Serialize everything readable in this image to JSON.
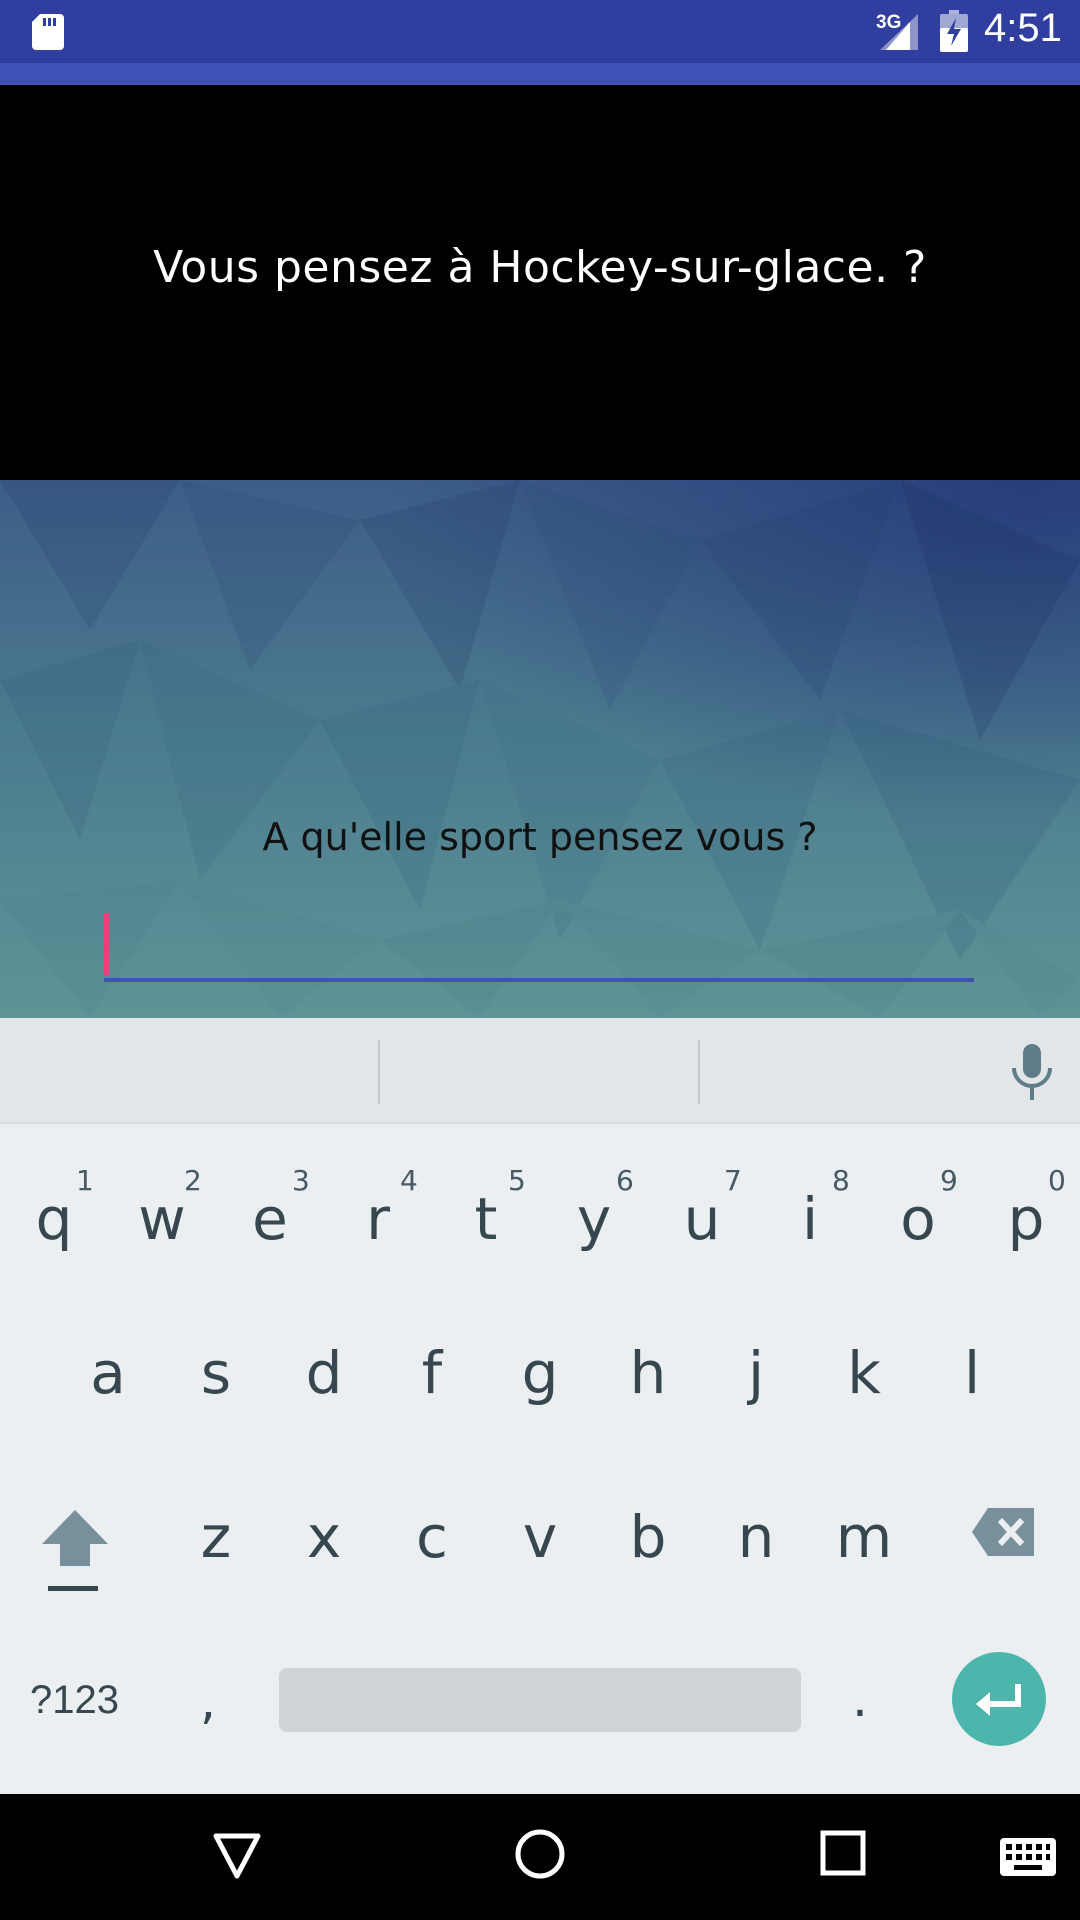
{
  "status_bar": {
    "network": "3G",
    "time": "4:51",
    "icons": [
      "sd-card-icon",
      "signal-icon",
      "battery-charging-icon"
    ]
  },
  "question": {
    "text": "Vous pensez à Hockey-sur-glace. ?"
  },
  "answer": {
    "prompt": "A qu'elle sport pensez vous ?",
    "input_value": ""
  },
  "keyboard": {
    "suggestions": [
      "",
      "",
      ""
    ],
    "row1": [
      {
        "letter": "q",
        "digit": "1"
      },
      {
        "letter": "w",
        "digit": "2"
      },
      {
        "letter": "e",
        "digit": "3"
      },
      {
        "letter": "r",
        "digit": "4"
      },
      {
        "letter": "t",
        "digit": "5"
      },
      {
        "letter": "y",
        "digit": "6"
      },
      {
        "letter": "u",
        "digit": "7"
      },
      {
        "letter": "i",
        "digit": "8"
      },
      {
        "letter": "o",
        "digit": "9"
      },
      {
        "letter": "p",
        "digit": "0"
      }
    ],
    "row2": [
      "a",
      "s",
      "d",
      "f",
      "g",
      "h",
      "j",
      "k",
      "l"
    ],
    "row3": [
      "z",
      "x",
      "c",
      "v",
      "b",
      "n",
      "m"
    ],
    "symbols_label": "?123",
    "comma_label": ",",
    "period_label": ".",
    "enter_color": "#4db6ac"
  },
  "colors": {
    "status_bar": "#303f9f",
    "app_bar": "#3f51b5",
    "input_underline": "#3f51b5",
    "cursor": "#e0457b"
  }
}
